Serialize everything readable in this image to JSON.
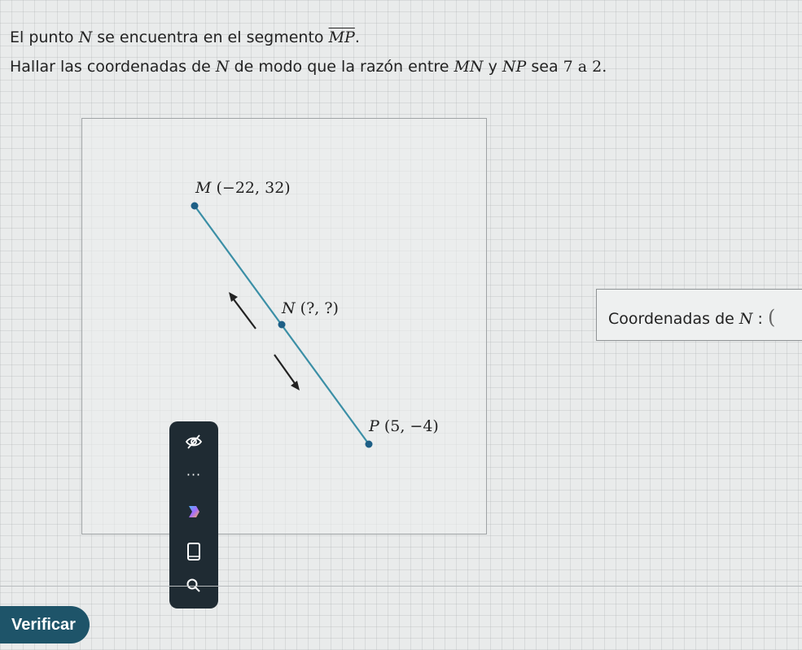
{
  "problem": {
    "line1_pre": "El punto",
    "line1_point": "N",
    "line1_mid": "se encuentra en el segmento",
    "line1_segment": "MP",
    "line1_end": ".",
    "line2_pre": "Hallar las coordenadas de",
    "line2_point": "N",
    "line2_mid": "de modo que la razón entre",
    "line2_seg1": "MN",
    "line2_y": "y",
    "line2_seg2": "NP",
    "line2_sea": "sea",
    "line2_ratio": "7 a 2."
  },
  "figure": {
    "point_m": {
      "name": "M",
      "coords": "(−22, 32)"
    },
    "point_n": {
      "name": "N",
      "coords": "(?, ?)"
    },
    "point_p": {
      "name": "P",
      "coords": "(5, −4)"
    },
    "colors": {
      "segment": "#3b8fa6",
      "point": "#1e5f86",
      "arrow": "#222222"
    }
  },
  "answer": {
    "label": "Coordenadas de",
    "point": "N",
    "colon": ":",
    "paren": "("
  },
  "toolbar": {
    "icons": [
      "eye-off-icon",
      "more-icon",
      "copilot-icon",
      "tablet-icon",
      "search-icon"
    ],
    "more_glyph": "···"
  },
  "actions": {
    "verify_label": "Verificar"
  }
}
